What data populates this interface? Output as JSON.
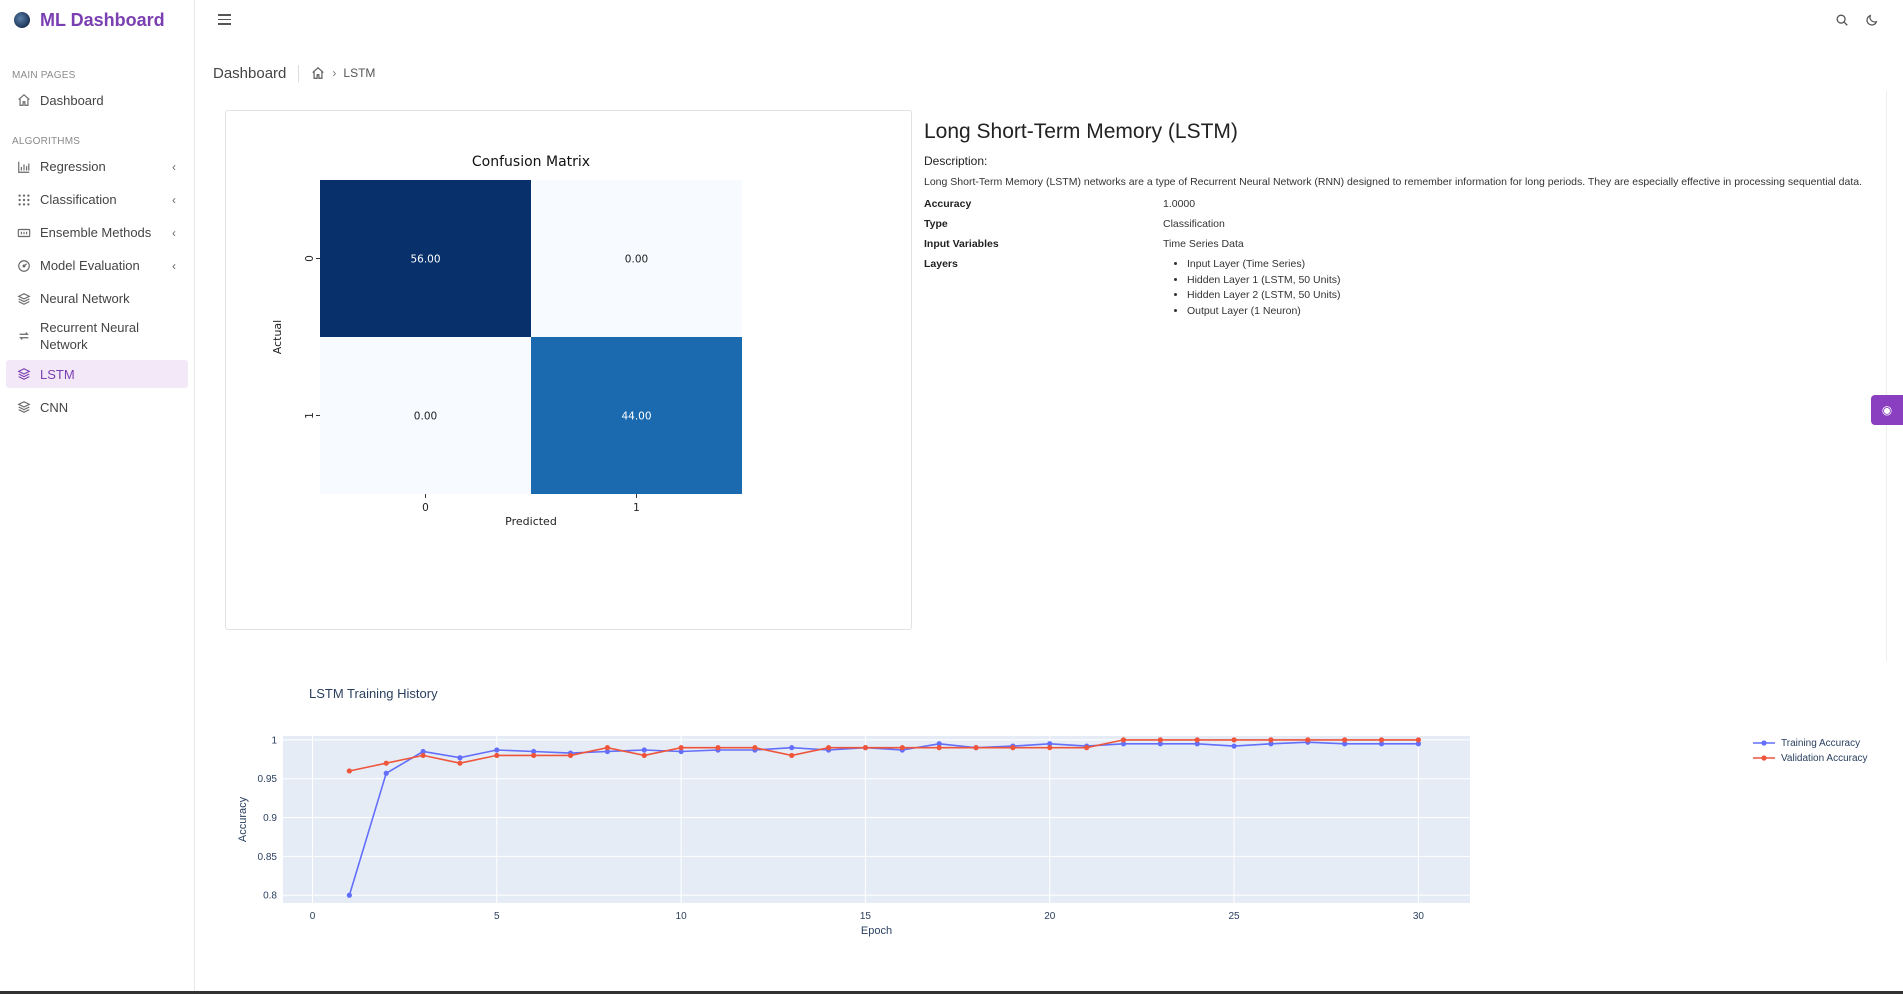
{
  "app": {
    "title": "ML Dashboard"
  },
  "sidebar": {
    "section_main": "MAIN PAGES",
    "section_algorithms": "ALGORITHMS",
    "items": [
      {
        "label": "Dashboard",
        "icon": "home-icon"
      },
      {
        "label": "Regression",
        "icon": "bar-chart-icon"
      },
      {
        "label": "Classification",
        "icon": "grid-icon"
      },
      {
        "label": "Ensemble Methods",
        "icon": "ensemble-icon"
      },
      {
        "label": "Model Evaluation",
        "icon": "gauge-icon"
      },
      {
        "label": "Neural Network",
        "icon": "layers-icon"
      },
      {
        "label": "Recurrent Neural Network",
        "icon": "repeat-icon"
      },
      {
        "label": "LSTM",
        "icon": "layers-icon"
      },
      {
        "label": "CNN",
        "icon": "layers-icon"
      }
    ],
    "active": "LSTM"
  },
  "breadcrumb": {
    "title": "Dashboard",
    "current": "LSTM"
  },
  "model": {
    "name": "Long Short-Term Memory (LSTM)",
    "description_label": "Description:",
    "description": "Long Short-Term Memory (LSTM) networks are a type of Recurrent Neural Network (RNN) designed to remember information for long periods. They are especially effective in processing sequential data.",
    "accuracy_label": "Accuracy",
    "accuracy": "1.0000",
    "type_label": "Type",
    "type": "Classification",
    "input_label": "Input Variables",
    "input": "Time Series Data",
    "layers_label": "Layers",
    "layers": [
      "Input Layer (Time Series)",
      "Hidden Layer 1 (LSTM, 50 Units)",
      "Hidden Layer 2 (LSTM, 50 Units)",
      "Output Layer (1 Neuron)"
    ]
  },
  "colors": {
    "accent": "#7a3fb0",
    "training": "#636efa",
    "validation": "#ef553b",
    "plot_bg": "#e5ecf6"
  },
  "chart_data": [
    {
      "type": "heatmap",
      "title": "Confusion Matrix",
      "xlabel": "Predicted",
      "ylabel": "Actual",
      "x_categories": [
        "0",
        "1"
      ],
      "y_categories": [
        "0",
        "1"
      ],
      "values": [
        [
          56,
          0
        ],
        [
          0,
          44
        ]
      ],
      "cell_labels": [
        [
          "56.00",
          "0.00"
        ],
        [
          "0.00",
          "44.00"
        ]
      ],
      "colors": [
        [
          "#08306b",
          "#f7fbff"
        ],
        [
          "#f7fbff",
          "#1b69ae"
        ]
      ]
    },
    {
      "type": "line",
      "title": "LSTM Training History",
      "xlabel": "Epoch",
      "ylabel": "Accuracy",
      "xlim": [
        -0.8,
        31.4
      ],
      "ylim": [
        0.79,
        1.005
      ],
      "xticks": [
        0,
        5,
        10,
        15,
        20,
        25,
        30
      ],
      "yticks": [
        0.8,
        0.85,
        0.9,
        0.95,
        1
      ],
      "ytick_labels": [
        "0.8",
        "0.85",
        "0.9",
        "0.95",
        "1"
      ],
      "legend_position": "top-right",
      "x": [
        1,
        2,
        3,
        4,
        5,
        6,
        7,
        8,
        9,
        10,
        11,
        12,
        13,
        14,
        15,
        16,
        17,
        18,
        19,
        20,
        21,
        22,
        23,
        24,
        25,
        26,
        27,
        28,
        29,
        30
      ],
      "series": [
        {
          "name": "Training Accuracy",
          "color": "#636efa",
          "values": [
            0.8,
            0.957,
            0.985,
            0.977,
            0.987,
            0.985,
            0.983,
            0.985,
            0.987,
            0.985,
            0.987,
            0.987,
            0.99,
            0.987,
            0.99,
            0.987,
            0.995,
            0.99,
            0.992,
            0.995,
            0.992,
            0.995,
            0.995,
            0.995,
            0.992,
            0.995,
            0.997,
            0.995,
            0.995,
            0.995
          ]
        },
        {
          "name": "Validation Accuracy",
          "color": "#ef553b",
          "values": [
            0.96,
            0.97,
            0.98,
            0.97,
            0.98,
            0.98,
            0.98,
            0.99,
            0.98,
            0.99,
            0.99,
            0.99,
            0.98,
            0.99,
            0.99,
            0.99,
            0.99,
            0.99,
            0.99,
            0.99,
            0.99,
            1.0,
            1.0,
            1.0,
            1.0,
            1.0,
            1.0,
            1.0,
            1.0,
            1.0
          ]
        }
      ]
    }
  ]
}
